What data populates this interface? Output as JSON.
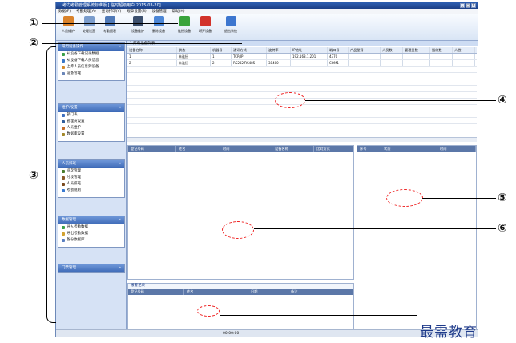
{
  "window": {
    "title": "考力考勤管理系统标准版 [ 临时超级用户 2015-03-20]",
    "controls": [
      "_",
      "□",
      "X"
    ]
  },
  "menu": [
    "数据(F)",
    "考勤处理(A)",
    "查询打印(V)",
    "规章设置(S)",
    "设备管理",
    "帮助(H)"
  ],
  "toolbar": [
    {
      "label": "人员维护",
      "icon": "people-icon",
      "color": "#d9822b"
    },
    {
      "label": "处理设置",
      "icon": "document-icon",
      "color": "#7a9ccc"
    },
    {
      "label": "考勤报表",
      "icon": "report-icon",
      "color": "#4f79b8"
    },
    {
      "label": "设备维护",
      "icon": "monitor-icon",
      "color": "#3b4f6e"
    },
    {
      "label": "删除设备",
      "icon": "delete-icon",
      "color": "#4c86d6"
    },
    {
      "label": "连接设备",
      "icon": "connect-icon",
      "color": "#39a33c"
    },
    {
      "label": "断开设备",
      "icon": "disconnect-icon",
      "color": "#d2332b"
    },
    {
      "label": "退出系统",
      "icon": "exit-icon",
      "color": "#3d76cf"
    }
  ],
  "sidebar": {
    "panes": [
      {
        "title": "常用设备操作",
        "items": [
          "从设备下载记录数据",
          "从设备下载人员信息",
          "上传人员信息到设备",
          "设备管理"
        ]
      },
      {
        "title": "维护/设置",
        "items": [
          "部门表",
          "管理员设置",
          "人员维护",
          "数据库设置"
        ]
      },
      {
        "title": "人员排班",
        "items": [
          "班次管理",
          "时段管理",
          "人员排班",
          "考勤规则"
        ]
      },
      {
        "title": "数据管理",
        "items": [
          "导入考勤数据",
          "导出考勤数据",
          "备份数据库"
        ]
      },
      {
        "title": "门禁管理",
        "items": []
      }
    ]
  },
  "main": {
    "tab": "1.所有设备列表",
    "grid": {
      "columns": [
        "设备名称",
        "状态",
        "机器号",
        "通讯方式",
        "波特率",
        "IP地址",
        "端口号",
        "产品型号",
        "人员数",
        "管理员数",
        "指纹数",
        "人脸"
      ],
      "rows": [
        [
          "1",
          "未连接",
          "1",
          "TCP/IP",
          "",
          "192.168.1.201",
          "4370",
          "",
          "",
          "",
          "",
          ""
        ],
        [
          "2",
          "未连接",
          "2",
          "RS232/RS485",
          "38400",
          "",
          "COM1",
          "",
          "",
          "",
          "",
          ""
        ]
      ]
    },
    "middle_left_columns": [
      "登记号码",
      "姓名",
      "时间",
      "设备名称",
      "比对方式"
    ],
    "right_columns": [
      "序号",
      "状态",
      "时间"
    ],
    "bottom": {
      "title": "报警记录",
      "columns": [
        "登记号码",
        "姓名",
        "日期",
        "备注"
      ]
    },
    "status_time": "00:00:00"
  },
  "callouts": [
    "①",
    "②",
    "③",
    "④",
    "⑤",
    "⑥"
  ],
  "watermark": "最需教育"
}
